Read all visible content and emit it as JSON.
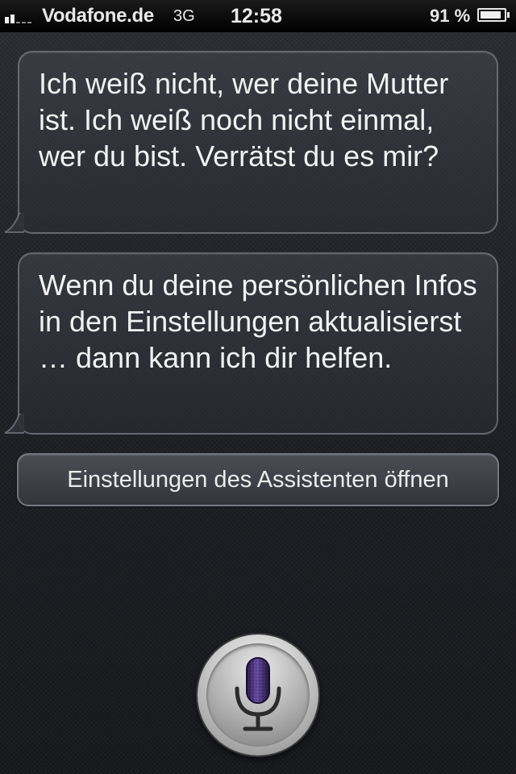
{
  "status_bar": {
    "carrier": "Vodafone.de",
    "network": "3G",
    "time": "12:58",
    "battery_percent_text": "91 %",
    "battery_level": 0.91,
    "signal_bars_filled": 2,
    "signal_bars_total": 5
  },
  "conversation": {
    "messages": [
      {
        "text": "Ich weiß nicht, wer deine Mutter ist. Ich weiß noch nicht einmal, wer du bist. Verrätst du es mir?"
      },
      {
        "text": "Wenn du deine persönlichen Infos in den Einstellungen aktualisierst … dann kann ich dir helfen."
      }
    ],
    "action_button_label": "Einstellungen des Assistenten öffnen"
  },
  "icons": {
    "mic": "microphone-icon",
    "battery": "battery-icon",
    "signal": "signal-strength-icon"
  },
  "colors": {
    "mic_accent": "#5a3e8e"
  }
}
